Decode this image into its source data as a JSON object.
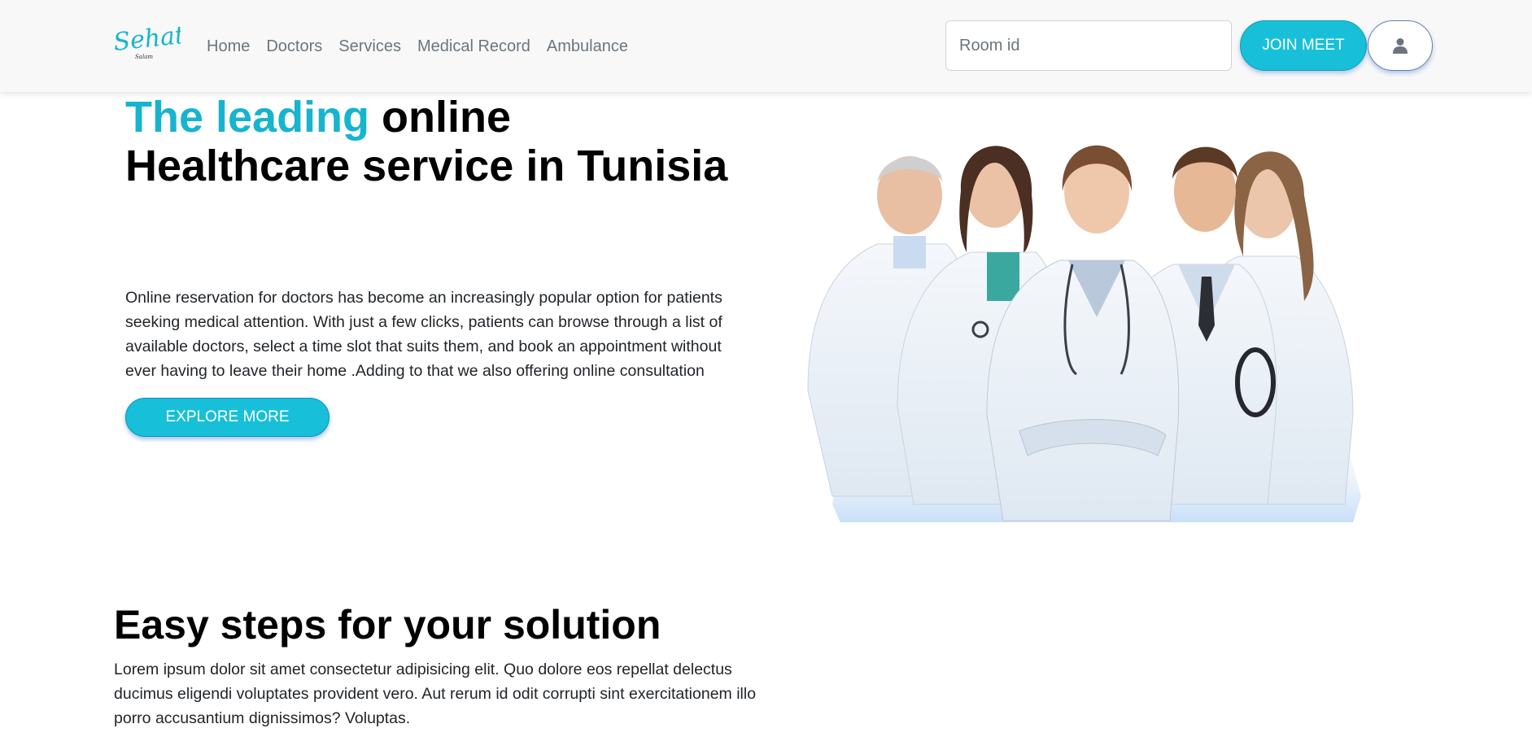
{
  "brand": {
    "logo_text": "Sehaty",
    "logo_subtext": "Salam"
  },
  "nav": {
    "items": [
      {
        "label": "Home"
      },
      {
        "label": "Doctors"
      },
      {
        "label": "Services"
      },
      {
        "label": "Medical Record"
      },
      {
        "label": "Ambulance"
      }
    ]
  },
  "room": {
    "placeholder": "Room id",
    "value": ""
  },
  "join_label": "JOIN MEET",
  "user_icon": "user-icon",
  "hero": {
    "title_accent": "The leading",
    "title_rest": " online Healthcare service in Tunisia",
    "paragraph": "Online reservation for doctors has become an increasingly popular option for patients seeking medical attention. With just a few clicks, patients can browse through a list of available doctors, select a time slot that suits them, and book an appointment without ever having to leave their home .Adding to that we also offering online consultation",
    "cta_label": "EXPLORE MORE"
  },
  "steps": {
    "title": "Easy steps for your solution",
    "paragraph": "Lorem ipsum dolor sit amet consectetur adipisicing elit. Quo dolore eos repellat delectus ducimus eligendi voluptates provident vero. Aut rerum id odit corrupti sint exercitationem illo porro accusantium dignissimos? Voluptas."
  },
  "colors": {
    "accent": "#17c0d8",
    "navbar_bg": "#f8f8f8",
    "text": "#212529",
    "muted": "#6c757d"
  }
}
